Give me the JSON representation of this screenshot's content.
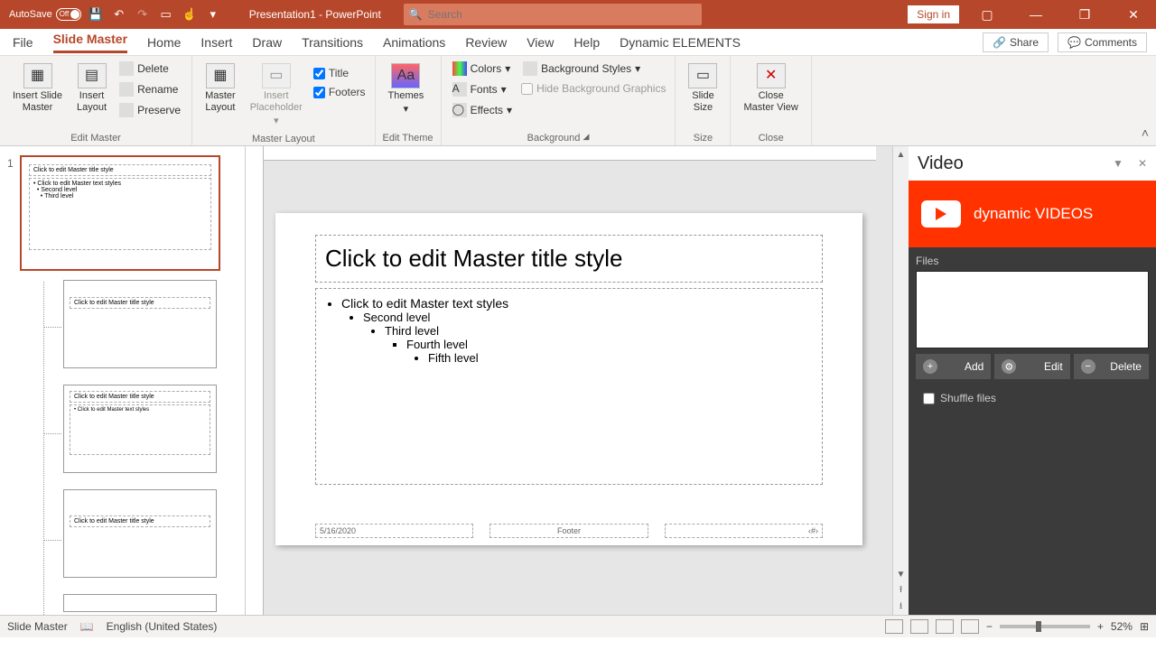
{
  "titlebar": {
    "autosave": "AutoSave",
    "autosave_state": "Off",
    "doc": "Presentation1 - PowerPoint",
    "search_ph": "Search",
    "signin": "Sign in"
  },
  "menu": {
    "items": [
      "File",
      "Slide Master",
      "Home",
      "Insert",
      "Draw",
      "Transitions",
      "Animations",
      "Review",
      "View",
      "Help",
      "Dynamic ELEMENTS"
    ],
    "active": "Slide Master",
    "share": "Share",
    "comments": "Comments"
  },
  "ribbon": {
    "edit_master": {
      "insert_master": "Insert Slide\nMaster",
      "insert_layout": "Insert\nLayout",
      "delete": "Delete",
      "rename": "Rename",
      "preserve": "Preserve",
      "label": "Edit Master"
    },
    "master_layout": {
      "master_layout": "Master\nLayout",
      "insert_ph": "Insert\nPlaceholder",
      "title": "Title",
      "footers": "Footers",
      "label": "Master Layout"
    },
    "edit_theme": {
      "themes": "Themes",
      "label": "Edit Theme"
    },
    "background": {
      "colors": "Colors",
      "fonts": "Fonts",
      "effects": "Effects",
      "bg_styles": "Background Styles",
      "hide_bg": "Hide Background Graphics",
      "label": "Background"
    },
    "size": {
      "slide_size": "Slide\nSize",
      "label": "Size"
    },
    "close": {
      "close_mv": "Close\nMaster View",
      "label": "Close"
    }
  },
  "thumbs": {
    "num1": "1",
    "master_title": "Click to edit Master title style",
    "master_text": "Click to edit Master text styles",
    "l2": "Second level",
    "l3": "Third level"
  },
  "slide": {
    "title": "Click to edit Master title style",
    "b1": "Click to edit Master text styles",
    "b2": "Second level",
    "b3": "Third level",
    "b4": "Fourth level",
    "b5": "Fifth level",
    "date": "5/16/2020",
    "footer": "Footer",
    "num": "‹#›"
  },
  "vid": {
    "title": "Video",
    "brand": "dynamic VIDEOS",
    "files": "Files",
    "add": "Add",
    "edit": "Edit",
    "delete": "Delete",
    "shuffle": "Shuffle files"
  },
  "status": {
    "mode": "Slide Master",
    "lang": "English (United States)",
    "zoom": "52%"
  }
}
